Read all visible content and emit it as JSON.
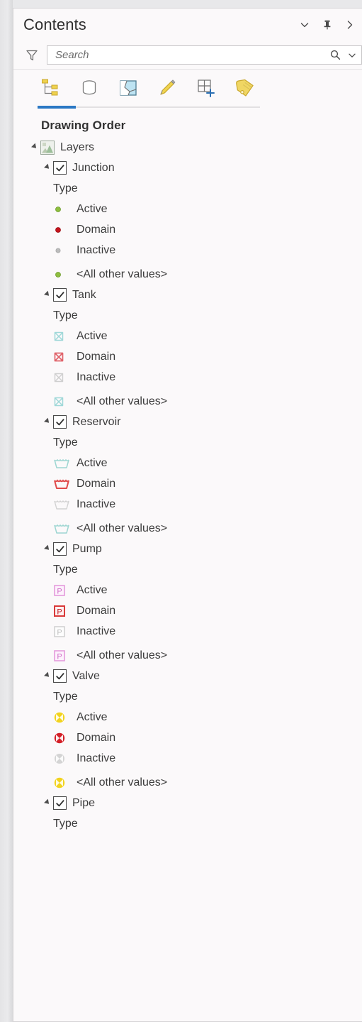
{
  "pane": {
    "title": "Contents",
    "title_buttons": [
      {
        "name": "menu-chevron",
        "icon": "chevron-down-icon"
      },
      {
        "name": "pin",
        "icon": "pin-icon"
      },
      {
        "name": "close",
        "icon": "close-icon"
      }
    ]
  },
  "search": {
    "placeholder": "Search",
    "value": "",
    "filter_icon": "filter-funnel-icon",
    "search_icon": "magnifier-icon",
    "dropdown_icon": "chevron-down-icon"
  },
  "tabs": [
    {
      "label": "Drawing Order",
      "icon": "drawing-order-icon",
      "active": true
    },
    {
      "label": "Data Source",
      "icon": "database-icon",
      "active": false
    },
    {
      "label": "Map Layers",
      "icon": "map-layer-icon",
      "active": false
    },
    {
      "label": "Editing",
      "icon": "pencil-icon",
      "active": false
    },
    {
      "label": "Snapping",
      "icon": "grid-plus-icon",
      "active": false
    },
    {
      "label": "Labeling",
      "icon": "tag-icon",
      "active": false
    }
  ],
  "active_tab_label": "Drawing Order",
  "colors": {
    "accent": "#2b78c4",
    "pane_bg": "#fbf9fa",
    "text": "#3c3c3c",
    "junction_active": "#8ebe3f",
    "junction_domain": "#c4141c",
    "junction_inactive": "#b6b6b6",
    "tank_active": "#9fd8d8",
    "tank_domain": "#e0636a",
    "tank_inactive": "#cfcfcf",
    "reservoir_active": "#9ed6d2",
    "reservoir_domain": "#e04a4a",
    "reservoir_inactive": "#d2d2d2",
    "pump_active": "#e8a8e0",
    "pump_domain": "#d93a3a",
    "pump_inactive": "#cccccc",
    "valve_active": "#f2d31e",
    "valve_domain": "#d42028",
    "valve_inactive": "#cfcfcf"
  },
  "tree": {
    "root": {
      "label": "Layers",
      "icon": "layers-raster-icon",
      "expanded": true,
      "checked": null
    },
    "layers": [
      {
        "name": "Junction",
        "checked": true,
        "expanded": true,
        "field": "Type",
        "symbol_shape": "circle",
        "classes": [
          {
            "label": "Active",
            "color": "#8ebe3f",
            "state": "active"
          },
          {
            "label": "Domain",
            "color": "#c4141c",
            "state": "domain"
          },
          {
            "label": "Inactive",
            "color": "#b6b6b6",
            "state": "inactive"
          },
          {
            "label": "<All other values>",
            "color": "#8ebe3f",
            "state": "other"
          }
        ]
      },
      {
        "name": "Tank",
        "checked": true,
        "expanded": true,
        "field": "Type",
        "symbol_shape": "tank",
        "classes": [
          {
            "label": "Active",
            "color": "#9fd8d8",
            "state": "active"
          },
          {
            "label": "Domain",
            "color": "#e0636a",
            "state": "domain"
          },
          {
            "label": "Inactive",
            "color": "#cfcfcf",
            "state": "inactive"
          },
          {
            "label": "<All other values>",
            "color": "#9fd8d8",
            "state": "other"
          }
        ]
      },
      {
        "name": "Reservoir",
        "checked": true,
        "expanded": true,
        "field": "Type",
        "symbol_shape": "reservoir",
        "classes": [
          {
            "label": "Active",
            "color": "#9ed6d2",
            "state": "active"
          },
          {
            "label": "Domain",
            "color": "#e04a4a",
            "state": "domain"
          },
          {
            "label": "Inactive",
            "color": "#d2d2d2",
            "state": "inactive"
          },
          {
            "label": "<All other values>",
            "color": "#9ed6d2",
            "state": "other"
          }
        ]
      },
      {
        "name": "Pump",
        "checked": true,
        "expanded": true,
        "field": "Type",
        "symbol_shape": "pump",
        "symbol_letter": "P",
        "classes": [
          {
            "label": "Active",
            "color": "#e49bdd",
            "state": "active"
          },
          {
            "label": "Domain",
            "color": "#d93a3a",
            "state": "domain"
          },
          {
            "label": "Inactive",
            "color": "#cccccc",
            "state": "inactive"
          },
          {
            "label": "<All other values>",
            "color": "#e49bdd",
            "state": "other"
          }
        ]
      },
      {
        "name": "Valve",
        "checked": true,
        "expanded": true,
        "field": "Type",
        "symbol_shape": "valve",
        "classes": [
          {
            "label": "Active",
            "color": "#f2d31e",
            "state": "active"
          },
          {
            "label": "Domain",
            "color": "#d42028",
            "state": "domain"
          },
          {
            "label": "Inactive",
            "color": "#cfcfcf",
            "state": "inactive"
          },
          {
            "label": "<All other values>",
            "color": "#f2d31e",
            "state": "other"
          }
        ]
      },
      {
        "name": "Pipe",
        "checked": true,
        "expanded": true,
        "field": "Type",
        "symbol_shape": "line",
        "classes": []
      }
    ]
  }
}
